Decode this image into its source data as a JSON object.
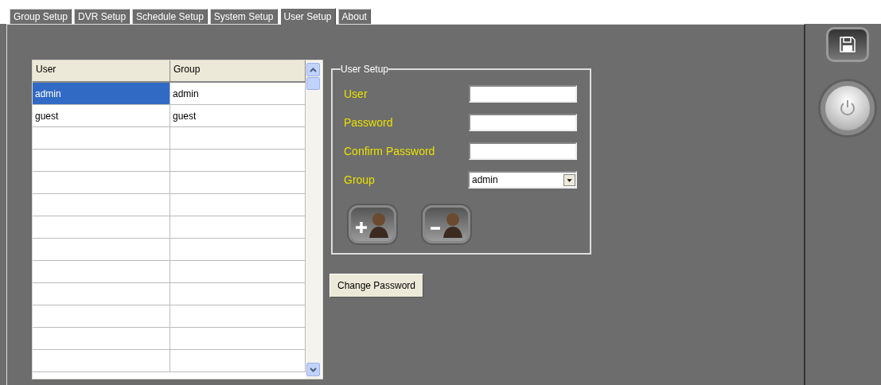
{
  "tabs": [
    {
      "label": "Group Setup",
      "selected": false
    },
    {
      "label": "DVR Setup",
      "selected": false
    },
    {
      "label": "Schedule Setup",
      "selected": false
    },
    {
      "label": "System Setup",
      "selected": false
    },
    {
      "label": "User Setup",
      "selected": true
    },
    {
      "label": "About",
      "selected": false
    }
  ],
  "user_table": {
    "columns": [
      "User",
      "Group"
    ],
    "rows": [
      {
        "cells": [
          "admin",
          "admin"
        ],
        "selected": true
      },
      {
        "cells": [
          "guest",
          "guest"
        ],
        "selected": false
      }
    ]
  },
  "user_setup": {
    "title": "User Setup",
    "fields": [
      {
        "kind": "text",
        "label": "User"
      },
      {
        "kind": "password",
        "label": "Password"
      },
      {
        "kind": "password",
        "label": "Confirm Password"
      },
      {
        "kind": "select",
        "label": "Group",
        "value": "admin"
      }
    ]
  },
  "change_password_button": "Change Password"
}
